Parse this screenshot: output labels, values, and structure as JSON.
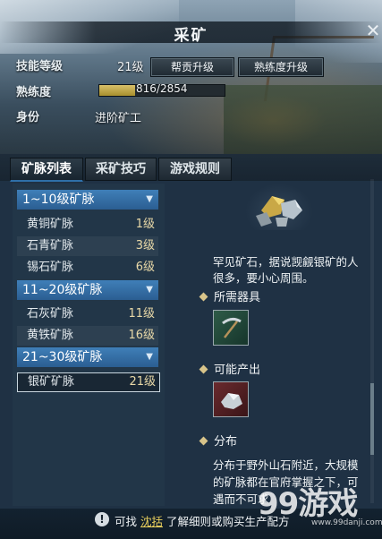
{
  "window": {
    "title": "采矿"
  },
  "info": {
    "skill_level_label": "技能等级",
    "skill_level_value": "21级",
    "proficiency_label": "熟练度",
    "proficiency_text": "816/2854",
    "proficiency_current": 816,
    "proficiency_max": 2854,
    "identity_label": "身份",
    "identity_value": "进阶矿工"
  },
  "buttons": {
    "contribution_upgrade": "帮贡升级",
    "proficiency_upgrade": "熟练度升级"
  },
  "tabs": [
    {
      "label": "矿脉列表",
      "active": true
    },
    {
      "label": "采矿技巧",
      "active": false
    },
    {
      "label": "游戏规则",
      "active": false
    }
  ],
  "groups": [
    {
      "label": "1~10级矿脉",
      "veins": [
        {
          "name": "黄铜矿脉",
          "level": "1级"
        },
        {
          "name": "石青矿脉",
          "level": "3级"
        },
        {
          "name": "锡石矿脉",
          "level": "6级"
        }
      ]
    },
    {
      "label": "11~20级矿脉",
      "veins": [
        {
          "name": "石灰矿脉",
          "level": "11级"
        },
        {
          "name": "黄铁矿脉",
          "level": "16级"
        }
      ]
    },
    {
      "label": "21~30级矿脉",
      "veins": [
        {
          "name": "银矿矿脉",
          "level": "21级",
          "selected": true
        }
      ]
    }
  ],
  "detail": {
    "description": "罕见矿石，据说觊觎银矿的人很多，要小心周围。",
    "required_tool_title": "所需器具",
    "possible_output_title": "可能产出",
    "distribution_title": "分布",
    "distribution_text": "分布于野外山石附近，大规模的矿脉都在官府掌握之下，可遇而不可求"
  },
  "footer": {
    "prefix": "可找",
    "link": "沈括",
    "suffix": "了解细则或购买生产配方"
  },
  "watermark": {
    "text": "99游戏",
    "url": "www.99danji.com"
  },
  "colors": {
    "accent_blue": "#3f7fb8",
    "gold": "#e8cf5d",
    "bar_fill": "#c4ab4c"
  }
}
